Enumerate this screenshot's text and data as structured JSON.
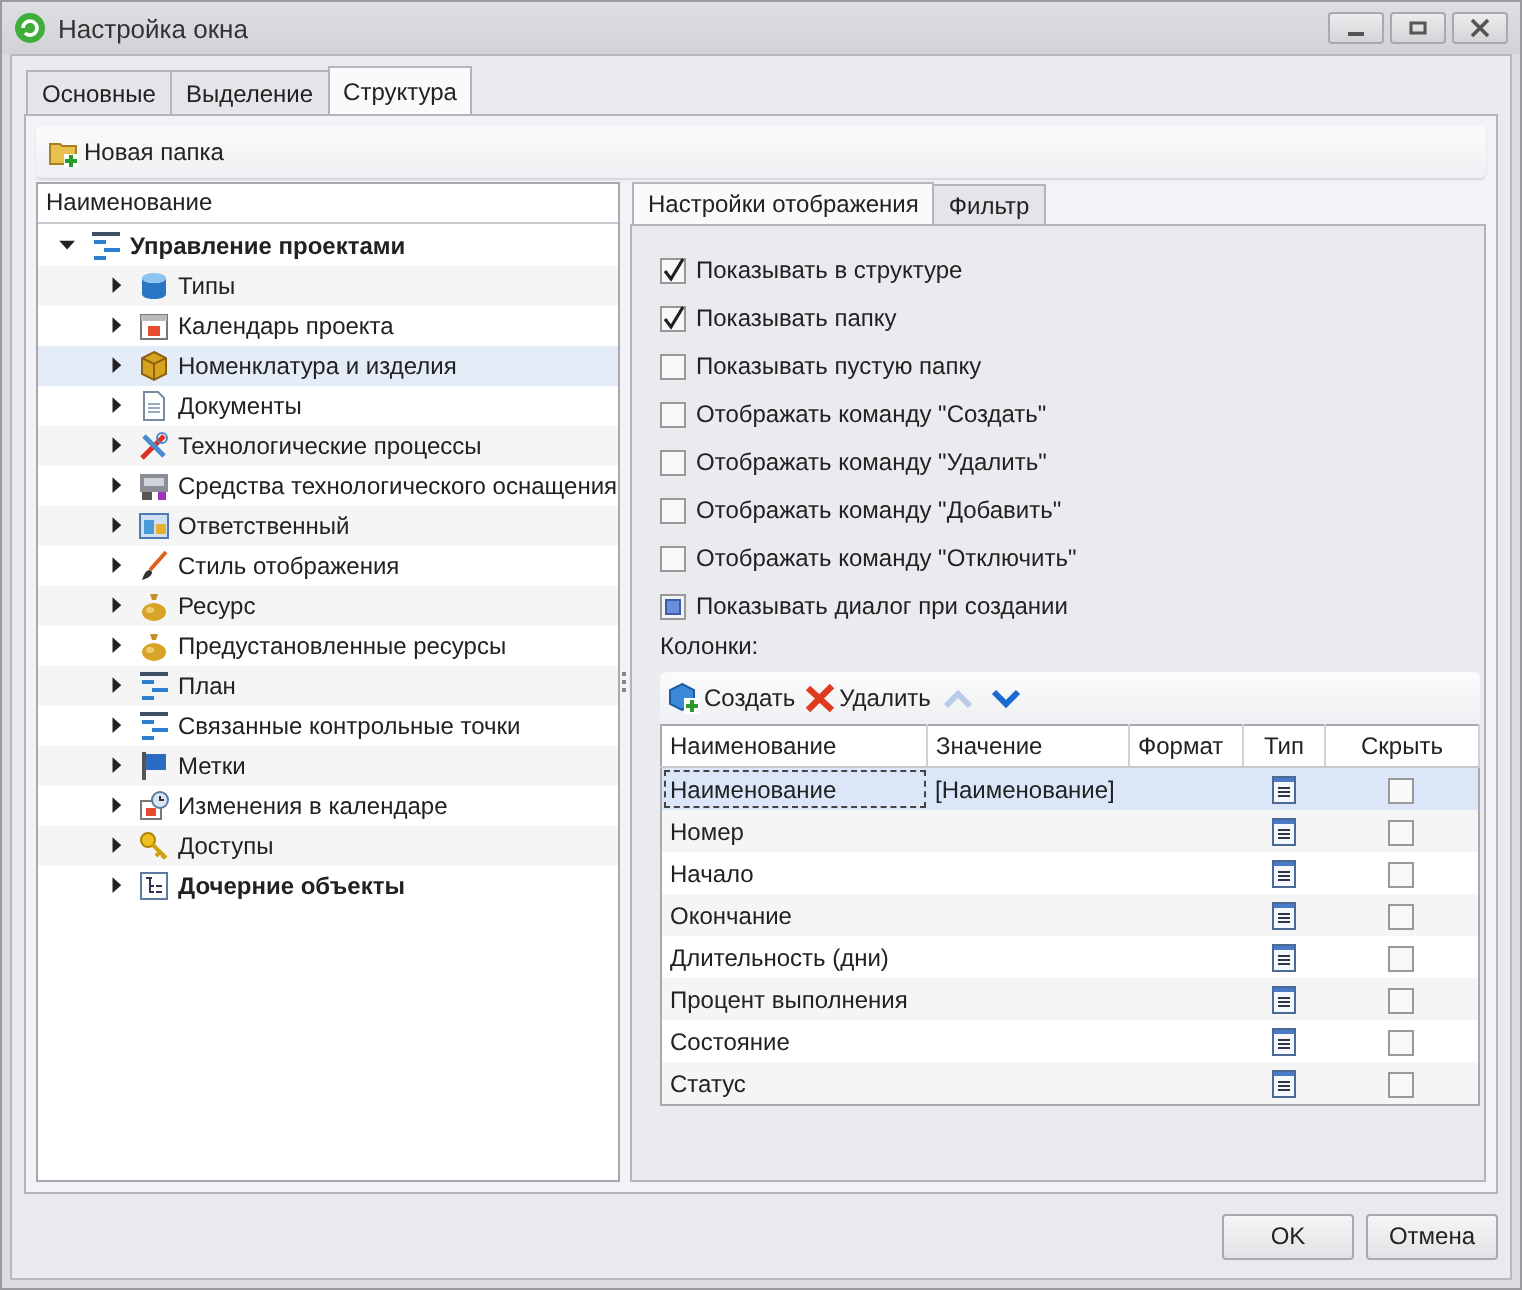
{
  "window": {
    "title": "Настройка окна"
  },
  "tabs": [
    {
      "label": "Основные",
      "selected": false
    },
    {
      "label": "Выделение",
      "selected": false
    },
    {
      "label": "Структура",
      "selected": true
    }
  ],
  "toolbar": {
    "new_folder": "Новая папка"
  },
  "tree": {
    "header": "Наименование",
    "items": [
      {
        "label": "Управление проектами",
        "bold": true,
        "expanded": true,
        "selected": false,
        "children": [
          {
            "label": "Типы",
            "bold": false,
            "expanded": false,
            "selected": false
          },
          {
            "label": "Календарь проекта",
            "bold": false,
            "expanded": false,
            "selected": false
          },
          {
            "label": "Номенклатура и изделия",
            "bold": false,
            "expanded": false,
            "selected": true
          },
          {
            "label": "Документы",
            "bold": false,
            "expanded": false,
            "selected": false
          },
          {
            "label": "Технологические процессы",
            "bold": false,
            "expanded": false,
            "selected": false
          },
          {
            "label": "Средства технологического оснащения",
            "bold": false,
            "expanded": false,
            "selected": false
          },
          {
            "label": "Ответственный",
            "bold": false,
            "expanded": false,
            "selected": false
          },
          {
            "label": "Стиль отображения",
            "bold": false,
            "expanded": false,
            "selected": false
          },
          {
            "label": "Ресурс",
            "bold": false,
            "expanded": false,
            "selected": false
          },
          {
            "label": "Предустановленные ресурсы",
            "bold": false,
            "expanded": false,
            "selected": false
          },
          {
            "label": "План",
            "bold": false,
            "expanded": false,
            "selected": false
          },
          {
            "label": "Связанные контрольные точки",
            "bold": false,
            "expanded": false,
            "selected": false
          },
          {
            "label": "Метки",
            "bold": false,
            "expanded": false,
            "selected": false
          },
          {
            "label": "Изменения в календаре",
            "bold": false,
            "expanded": false,
            "selected": false
          },
          {
            "label": "Доступы",
            "bold": false,
            "expanded": false,
            "selected": false
          },
          {
            "label": "Дочерние объекты",
            "bold": true,
            "expanded": false,
            "selected": false
          }
        ]
      }
    ]
  },
  "inner_tabs": [
    {
      "label": "Настройки отображения",
      "selected": true
    },
    {
      "label": "Фильтр",
      "selected": false
    }
  ],
  "options": [
    {
      "label": "Показывать в структуре",
      "checked": true,
      "indeterminate": false
    },
    {
      "label": "Показывать папку",
      "checked": true,
      "indeterminate": false
    },
    {
      "label": "Показывать пустую папку",
      "checked": false,
      "indeterminate": false
    },
    {
      "label": "Отображать команду \"Создать\"",
      "checked": false,
      "indeterminate": false
    },
    {
      "label": "Отображать команду \"Удалить\"",
      "checked": false,
      "indeterminate": false
    },
    {
      "label": "Отображать команду \"Добавить\"",
      "checked": false,
      "indeterminate": false
    },
    {
      "label": "Отображать команду \"Отключить\"",
      "checked": false,
      "indeterminate": false
    },
    {
      "label": "Показывать диалог при создании",
      "checked": false,
      "indeterminate": true
    }
  ],
  "columns_label": "Колонки:",
  "columns_toolbar": {
    "create": "Создать",
    "delete": "Удалить",
    "move_up_disabled": true,
    "move_down_disabled": false
  },
  "table": {
    "columns": [
      "Наименование",
      "Значение",
      "Формат",
      "Тип",
      "Скрыть"
    ],
    "rows": [
      {
        "name": "Наименование",
        "value": "[Наименование]",
        "hidden": false,
        "selected": true
      },
      {
        "name": "Номер",
        "hidden": false,
        "selected": false
      },
      {
        "name": "Начало",
        "hidden": false,
        "selected": false
      },
      {
        "name": "Окончание",
        "hidden": false,
        "selected": false
      },
      {
        "name": "Длительность (дни)",
        "hidden": false,
        "selected": false
      },
      {
        "name": "Процент выполнения",
        "hidden": false,
        "selected": false
      },
      {
        "name": "Состояние",
        "hidden": false,
        "selected": false
      },
      {
        "name": "Статус",
        "hidden": false,
        "selected": false
      }
    ]
  },
  "buttons": [
    {
      "label": "OK"
    },
    {
      "label": "Отмена"
    }
  ]
}
